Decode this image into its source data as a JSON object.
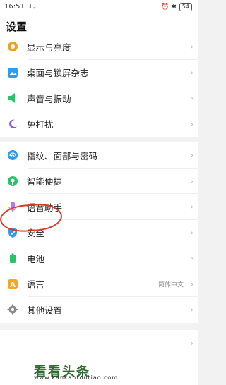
{
  "status_bar": {
    "time": "16:51",
    "signal": "..ıl ᯤ",
    "right_icons": "⏰ ✱",
    "battery": "54"
  },
  "header": {
    "title": "设置"
  },
  "sections": [
    {
      "items": [
        {
          "label": "显示与亮度",
          "icon": "brightness-icon",
          "color": "#f0a020"
        },
        {
          "label": "桌面与锁屏杂志",
          "icon": "wallpaper-icon",
          "color": "#2e9bf0"
        },
        {
          "label": "声音与振动",
          "icon": "speaker-icon",
          "color": "#2bc36a"
        },
        {
          "label": "免打扰",
          "icon": "moon-icon",
          "color": "#8a5ce6"
        }
      ]
    },
    {
      "items": [
        {
          "label": "指纹、面部与密码",
          "icon": "fingerprint-icon",
          "color": "#2e9bf0"
        },
        {
          "label": "智能便捷",
          "icon": "smart-icon",
          "color": "#2bc36a"
        },
        {
          "label": "语音助手",
          "icon": "microphone-icon",
          "color": "#b47ae8"
        },
        {
          "label": "安全",
          "icon": "shield-icon",
          "color": "#2e9bf0"
        },
        {
          "label": "电池",
          "icon": "battery-icon",
          "color": "#2bc36a"
        },
        {
          "label": "语言",
          "icon": "language-icon",
          "color": "#f5a623",
          "value": "简体中文"
        },
        {
          "label": "其他设置",
          "icon": "gear-icon",
          "color": "#8a8a8a"
        }
      ]
    }
  ],
  "watermark": {
    "main": "看看头条",
    "url": "www.kankantoutiao.com"
  },
  "colors": {
    "annotation": "#d83a2a"
  }
}
